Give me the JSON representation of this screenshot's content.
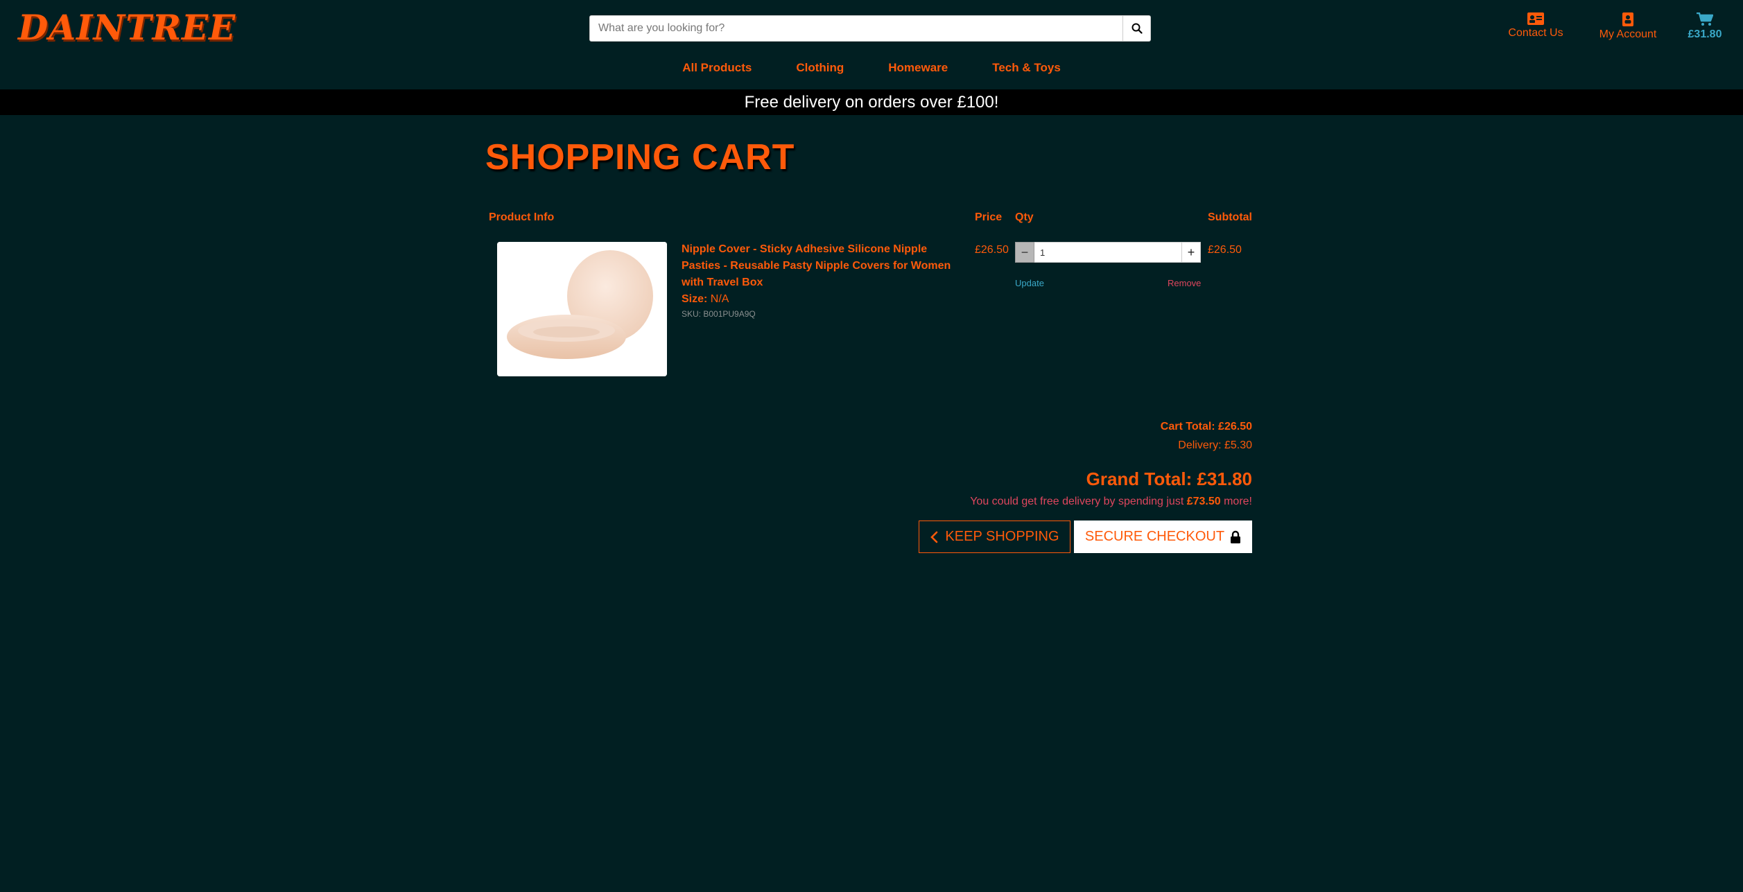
{
  "header": {
    "logo_text": "DAINTREE",
    "search": {
      "placeholder": "What are you looking for?",
      "value": ""
    },
    "contact_label": "Contact Us",
    "account_label": "My Account",
    "cart_total": "£31.80"
  },
  "nav": {
    "items": [
      "All Products",
      "Clothing",
      "Homeware",
      "Tech & Toys"
    ]
  },
  "promo_text": "Free delivery on orders over £100!",
  "cart": {
    "title": "SHOPPING CART",
    "columns": {
      "product_info": "Product Info",
      "price": "Price",
      "qty": "Qty",
      "subtotal": "Subtotal"
    },
    "items": [
      {
        "name": "Nipple Cover - Sticky Adhesive Silicone Nipple Pasties - Reusable Pasty Nipple Covers for Women with Travel Box",
        "size_label": "Size:",
        "size_value": "N/A",
        "sku": "SKU: B001PU9A9Q",
        "price": "£26.50",
        "qty": "1",
        "subtotal": "£26.50",
        "update_label": "Update",
        "remove_label": "Remove"
      }
    ],
    "cart_total": "Cart Total: £26.50",
    "delivery": "Delivery: £5.30",
    "grand_total": "Grand Total: £31.80",
    "free_delivery": {
      "prefix": "You could get free delivery by spending just ",
      "amount": "£73.50",
      "suffix": " more!"
    },
    "keep_shopping_label": "KEEP SHOPPING",
    "secure_checkout_label": "SECURE CHECKOUT"
  },
  "colors": {
    "background": "#011f22",
    "accent": "#ff5a0a",
    "cart_accent": "#3aa8c8",
    "remove": "#e0465e"
  },
  "icons": [
    "search-icon",
    "contact-card-icon",
    "account-icon",
    "cart-icon",
    "chevron-left-icon",
    "lock-icon",
    "minus-icon",
    "plus-icon"
  ]
}
